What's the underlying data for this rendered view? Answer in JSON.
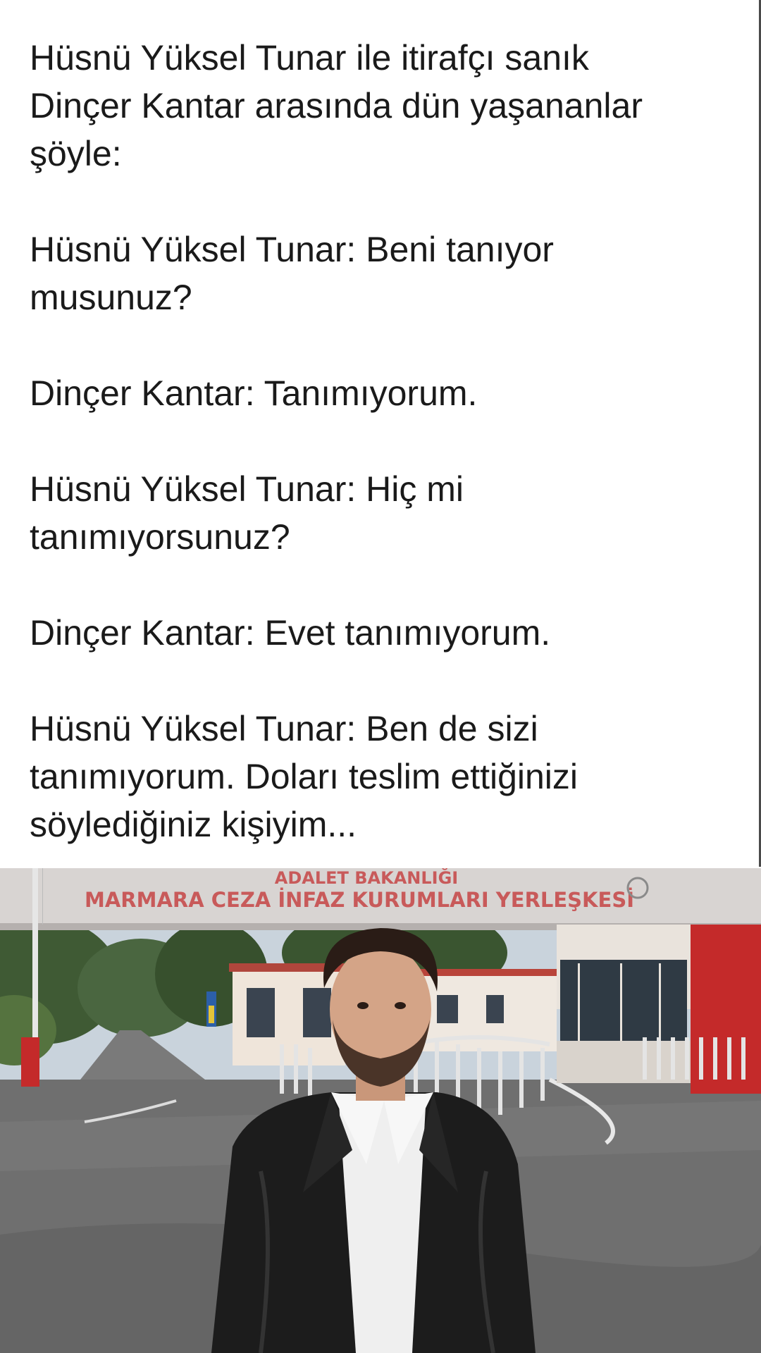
{
  "post": {
    "paragraphs": [
      "Hüsnü Yüksel Tunar ile itirafçı sanık\nDinçer Kantar arasında dün yaşananlar\nşöyle:",
      "Hüsnü Yüksel Tunar: Beni tanıyor\nmusunuz?",
      "Dinçer Kantar: Tanımıyorum.",
      "Hüsnü Yüksel Tunar: Hiç mi\ntanımıyorsunuz?",
      "Dinçer Kantar: Evet tanımıyorum.",
      "Hüsnü Yüksel Tunar: Ben de sizi\ntanımıyorum. Doları teslim ettiğinizi\nsöylediğiniz kişiyim..."
    ]
  },
  "photo": {
    "sign_top": "ADALET BAKANLIĞI",
    "sign_main": "MARMARA CEZA İNFAZ KURUMLARI YERLEŞKESİ"
  },
  "colors": {
    "text": "#1a1a1a",
    "sign_text": "#c85a5a",
    "sky": "#c9d3dc",
    "asphalt": "#6f6f6f",
    "red_wall": "#c42a2a",
    "jacket": "#1c1c1c"
  }
}
